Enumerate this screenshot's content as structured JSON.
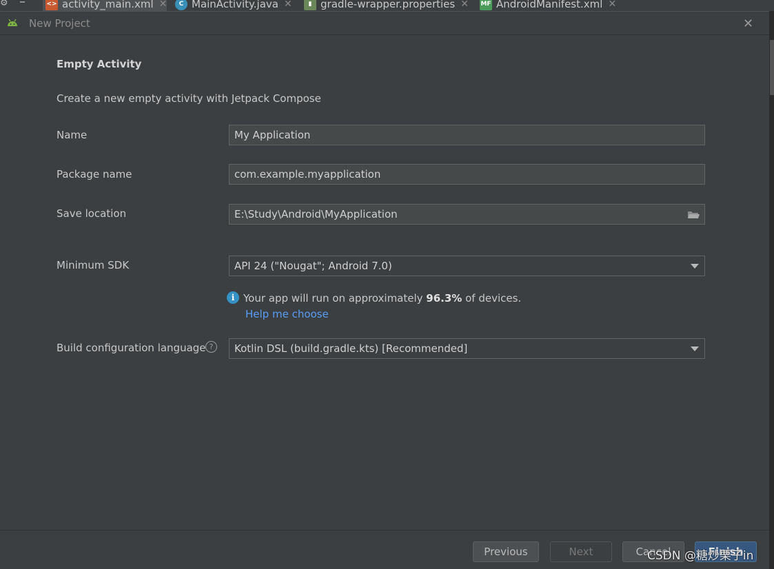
{
  "editor_tabs": [
    {
      "label": "activity_main.xml",
      "icon": "xml-file-icon",
      "active": true
    },
    {
      "label": "MainActivity.java",
      "icon": "java-class-icon"
    },
    {
      "label": "gradle-wrapper.properties",
      "icon": "properties-file-icon"
    },
    {
      "label": "AndroidManifest.xml",
      "icon": "manifest-file-icon"
    }
  ],
  "dialog": {
    "title": "New Project",
    "heading": "Empty Activity",
    "description": "Create a new empty activity with Jetpack Compose"
  },
  "form": {
    "name_label": "Name",
    "name_value": "My Application",
    "package_label": "Package name",
    "package_value": "com.example.myapplication",
    "save_label": "Save location",
    "save_value": "E:\\Study\\Android\\MyApplication",
    "min_sdk_label": "Minimum SDK",
    "min_sdk_value": "API 24 (\"Nougat\"; Android 7.0)",
    "info_prefix": "Your app will run on approximately ",
    "info_percent": "96.3%",
    "info_suffix": " of devices.",
    "help_link": "Help me choose",
    "build_lang_label": "Build configuration language",
    "build_lang_value": "Kotlin DSL (build.gradle.kts) [Recommended]"
  },
  "buttons": {
    "previous": "Previous",
    "next": "Next",
    "cancel": "Cancel",
    "finish": "Finish"
  },
  "watermark": "CSDN @糖炒栗子in",
  "colors": {
    "accent_link": "#589df6",
    "info_icon": "#3592c4",
    "primary_button": "#365880",
    "background": "#3c3f41"
  }
}
